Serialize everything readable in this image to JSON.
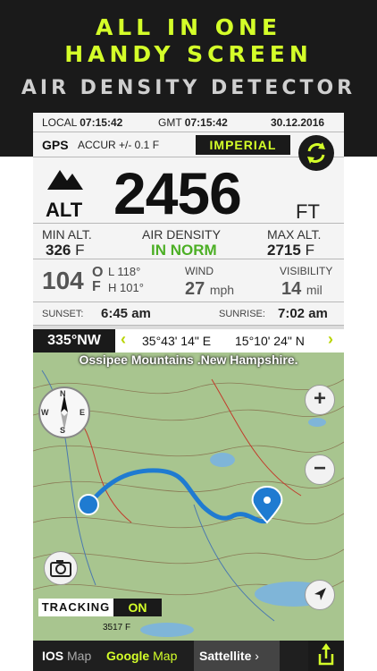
{
  "promo": {
    "line1": "ALL IN ONE",
    "line2": "HANDY SCREEN",
    "subtitle": "AIR DENSITY DETECTOR"
  },
  "time_row": {
    "local_label": "LOCAL",
    "local_time": "07:15:42",
    "gmt_label": "GMT",
    "gmt_time": "07:15:42",
    "date": "30.12.2016"
  },
  "gps": {
    "label": "GPS",
    "accuracy": "ACCUR +/- 0.1 F",
    "unit_mode": "IMPERIAL",
    "sync_icon": "sync-icon"
  },
  "altitude": {
    "label": "ALT",
    "value": "2456",
    "unit": "FT",
    "icon": "mountain-icon"
  },
  "stats": {
    "min_label": "MIN ALT.",
    "min_value": "326",
    "min_unit": "F",
    "density_label": "AIR DENSITY",
    "density_value": "IN NORM",
    "max_label": "MAX ALT.",
    "max_value": "2715",
    "max_unit": "F"
  },
  "weather": {
    "temp": "104",
    "temp_unit_o": "O",
    "temp_unit_f": "F",
    "low_label": "L",
    "low": "118°",
    "high_label": "H",
    "high": "101°",
    "wind_label": "WIND",
    "wind_value": "27",
    "wind_unit": "mph",
    "visibility_label": "VISIBILITY",
    "visibility_value": "14",
    "visibility_unit": "mil"
  },
  "sun": {
    "sunset_label": "SUNSET:",
    "sunset_time": "6:45 am",
    "sunrise_label": "SUNRISE:",
    "sunrise_time": "7:02 am"
  },
  "nav": {
    "heading": "335°NW",
    "left_chevron": "‹",
    "latitude": "35°43' 14\" E",
    "longitude": "15°10' 24\" N",
    "right_chevron": "›"
  },
  "map": {
    "title": "Ossipee Mountains .New Hampshire.",
    "zoom_in": "+",
    "zoom_out": "−",
    "scale_text": "3517 F",
    "compass_letters": [
      "N",
      "E",
      "S",
      "W"
    ],
    "colors": {
      "route": "#1f7bd1",
      "marker": "#1f7bd1",
      "water": "#7fb5d8"
    }
  },
  "tracking": {
    "label": "TRACKING",
    "state": "ON"
  },
  "bottom_tabs": [
    {
      "bold": "IOS",
      "word": "Map"
    },
    {
      "bold": "Google",
      "word": "Map"
    },
    {
      "bold": "Sattellite",
      "word": "›"
    }
  ],
  "colors": {
    "accent": "#d4ff29",
    "density_green": "#4caf25",
    "dark": "#1a1a1a"
  }
}
